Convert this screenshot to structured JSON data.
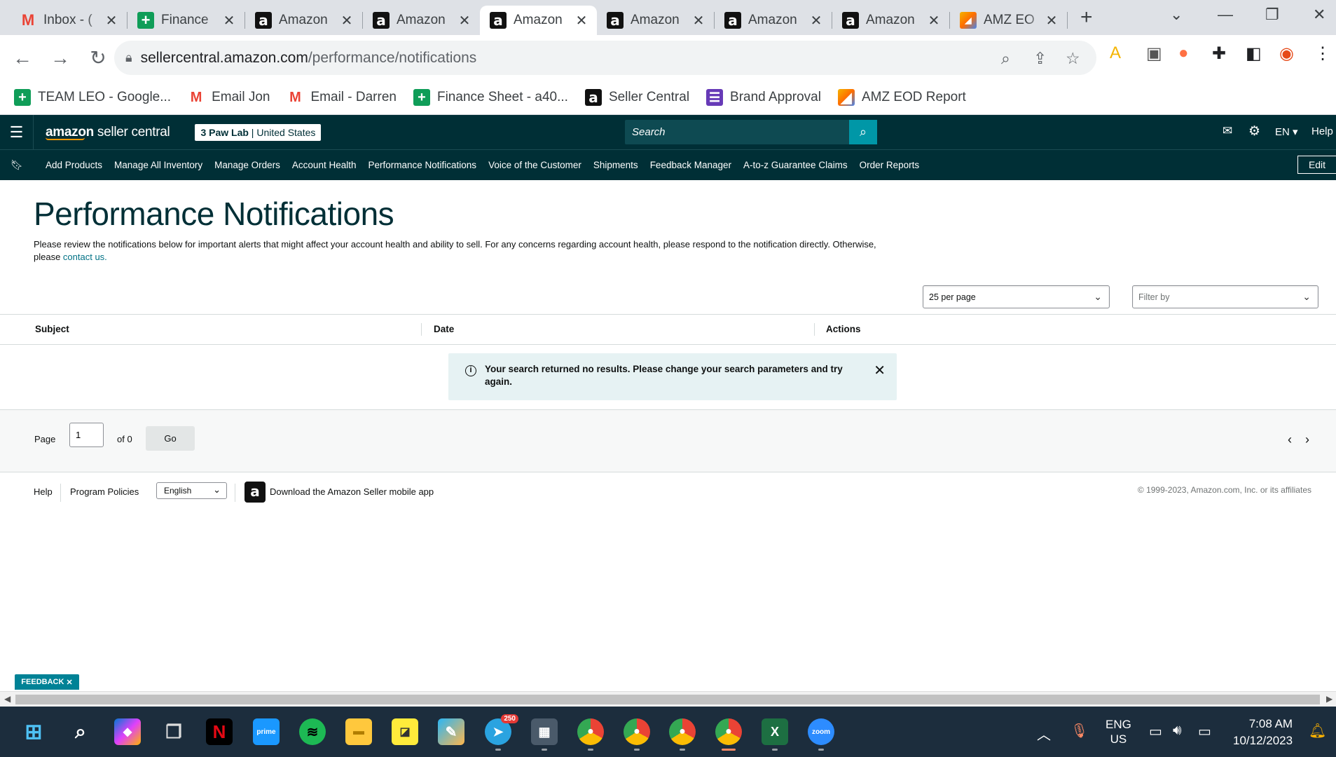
{
  "browser": {
    "tabs": [
      {
        "title": "Inbox - (",
        "icon": "gmail-icon",
        "active": false
      },
      {
        "title": "Finance",
        "icon": "sheets-icon",
        "active": false
      },
      {
        "title": "Amazon",
        "icon": "amazon-icon",
        "active": false
      },
      {
        "title": "Amazon",
        "icon": "amazon-icon",
        "active": false
      },
      {
        "title": "Amazon",
        "icon": "amazon-icon",
        "active": true
      },
      {
        "title": "Amazon",
        "icon": "amazon-icon",
        "active": false
      },
      {
        "title": "Amazon",
        "icon": "amazon-icon",
        "active": false
      },
      {
        "title": "Amazon",
        "icon": "amazon-icon",
        "active": false
      },
      {
        "title": "AMZ EO",
        "icon": "amz-eod-icon",
        "active": false
      }
    ],
    "url_host": "sellercentral.amazon.com",
    "url_path": "/performance/notifications",
    "bookmarks": [
      {
        "label": "TEAM LEO - Google...",
        "icon": "sheets-icon"
      },
      {
        "label": "Email Jon",
        "icon": "gmail-icon"
      },
      {
        "label": "Email - Darren",
        "icon": "gmail-icon"
      },
      {
        "label": "Finance Sheet - a40...",
        "icon": "sheets-icon"
      },
      {
        "label": "Seller Central",
        "icon": "amazon-icon"
      },
      {
        "label": "Brand Approval",
        "icon": "forms-icon"
      },
      {
        "label": "AMZ EOD Report",
        "icon": "amz-eod-icon"
      }
    ]
  },
  "header": {
    "logo_bold": "amazon",
    "logo_rest": " seller central",
    "store_name": "3 Paw Lab",
    "store_region": "United States",
    "search_placeholder": "Search",
    "language": "EN",
    "help": "Help"
  },
  "nav": {
    "items": [
      "Add Products",
      "Manage All Inventory",
      "Manage Orders",
      "Account Health",
      "Performance Notifications",
      "Voice of the Customer",
      "Shipments",
      "Feedback Manager",
      "A-to-z Guarantee Claims",
      "Order Reports"
    ],
    "edit": "Edit"
  },
  "page": {
    "title": "Performance Notifications",
    "intro_text": "Please review the notifications below for important alerts that might affect your account health and ability to sell. For any concerns regarding account health, please respond to the notification directly. Otherwise, please ",
    "intro_link": "contact us.",
    "per_page": "25 per page",
    "filter_placeholder": "Filter by",
    "columns": {
      "subject": "Subject",
      "date": "Date",
      "actions": "Actions"
    },
    "alert_message": "Your search returned no results. Please change your search parameters and try again.",
    "pager": {
      "page_label": "Page",
      "page_value": "1",
      "of_label": "of 0",
      "go": "Go"
    }
  },
  "footer": {
    "help": "Help",
    "policies": "Program Policies",
    "language": "English",
    "app_download": "Download the Amazon Seller mobile app",
    "copyright": "© 1999-2023, Amazon.com, Inc. or its affiliates"
  },
  "feedback": "FEEDBACK",
  "taskbar": {
    "language_line1": "ENG",
    "language_line2": "US",
    "time": "7:08 AM",
    "date": "10/12/2023",
    "telegram_badge": "250"
  },
  "colors": {
    "header_bg": "#002f36",
    "link": "#007185",
    "alert_bg": "#e6f2f3",
    "feedback_bg": "#008296"
  }
}
